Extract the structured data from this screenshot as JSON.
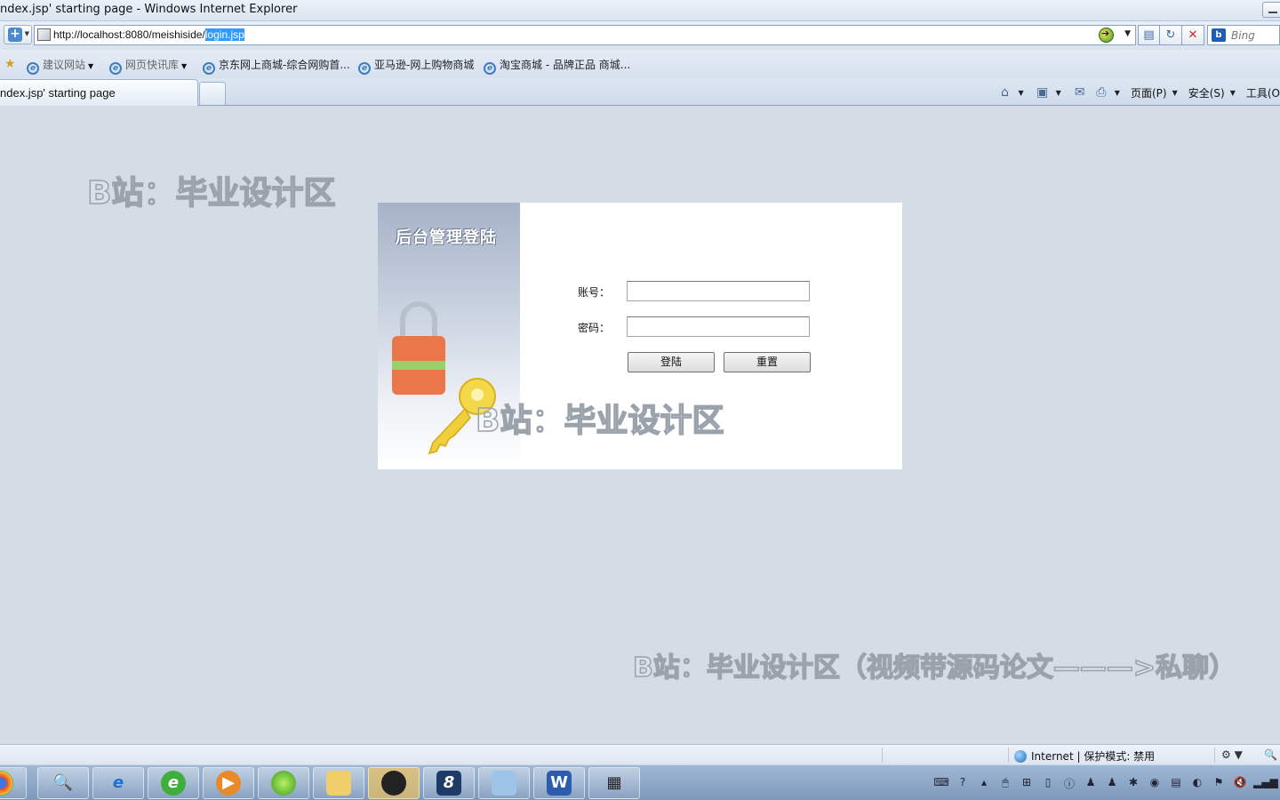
{
  "window": {
    "title": "ndex.jsp' starting page - Windows Internet Explorer"
  },
  "address_bar": {
    "url_prefix": "http://localhost:8080/meishiside/",
    "url_selected": "login.jsp",
    "search_placeholder": "Bing"
  },
  "favorites": {
    "items": [
      {
        "label": "建议网站",
        "dropdown": true
      },
      {
        "label": "网页快讯库",
        "dropdown": true
      },
      {
        "label": "京东网上商城-综合网购首..."
      },
      {
        "label": "亚马逊-网上购物商城"
      },
      {
        "label": "淘宝商城 - 品牌正品 商城..."
      }
    ]
  },
  "tabs": {
    "active_label": "ndex.jsp' starting page"
  },
  "command_bar": {
    "page_menu": "页面(P)",
    "safety_menu": "安全(S)",
    "tools_menu": "工具(O"
  },
  "login": {
    "heading": "后台管理登陆",
    "account_label": "账号：",
    "password_label": "密码：",
    "account_value": "",
    "password_value": "",
    "login_button": "登陆",
    "reset_button": "重置"
  },
  "watermarks": {
    "top_left": "B站：毕业设计区",
    "center": "B站：毕业设计区",
    "bottom": "B站：毕业设计区（视频带源码论文———>私聊）"
  },
  "status_bar": {
    "zone_text": "Internet | 保护模式: 禁用"
  },
  "taskbar": {
    "apps": [
      "chrome-icon",
      "search-icon",
      "ie-icon",
      "ie-green-icon",
      "media-player-icon",
      "ball-icon",
      "folder-icon",
      "qq-icon",
      "app-8-icon",
      "notepad-icon",
      "word-icon",
      "recorder-icon"
    ]
  },
  "colors": {
    "content_bg": "#d4dce6",
    "selection": "#3399ff"
  }
}
